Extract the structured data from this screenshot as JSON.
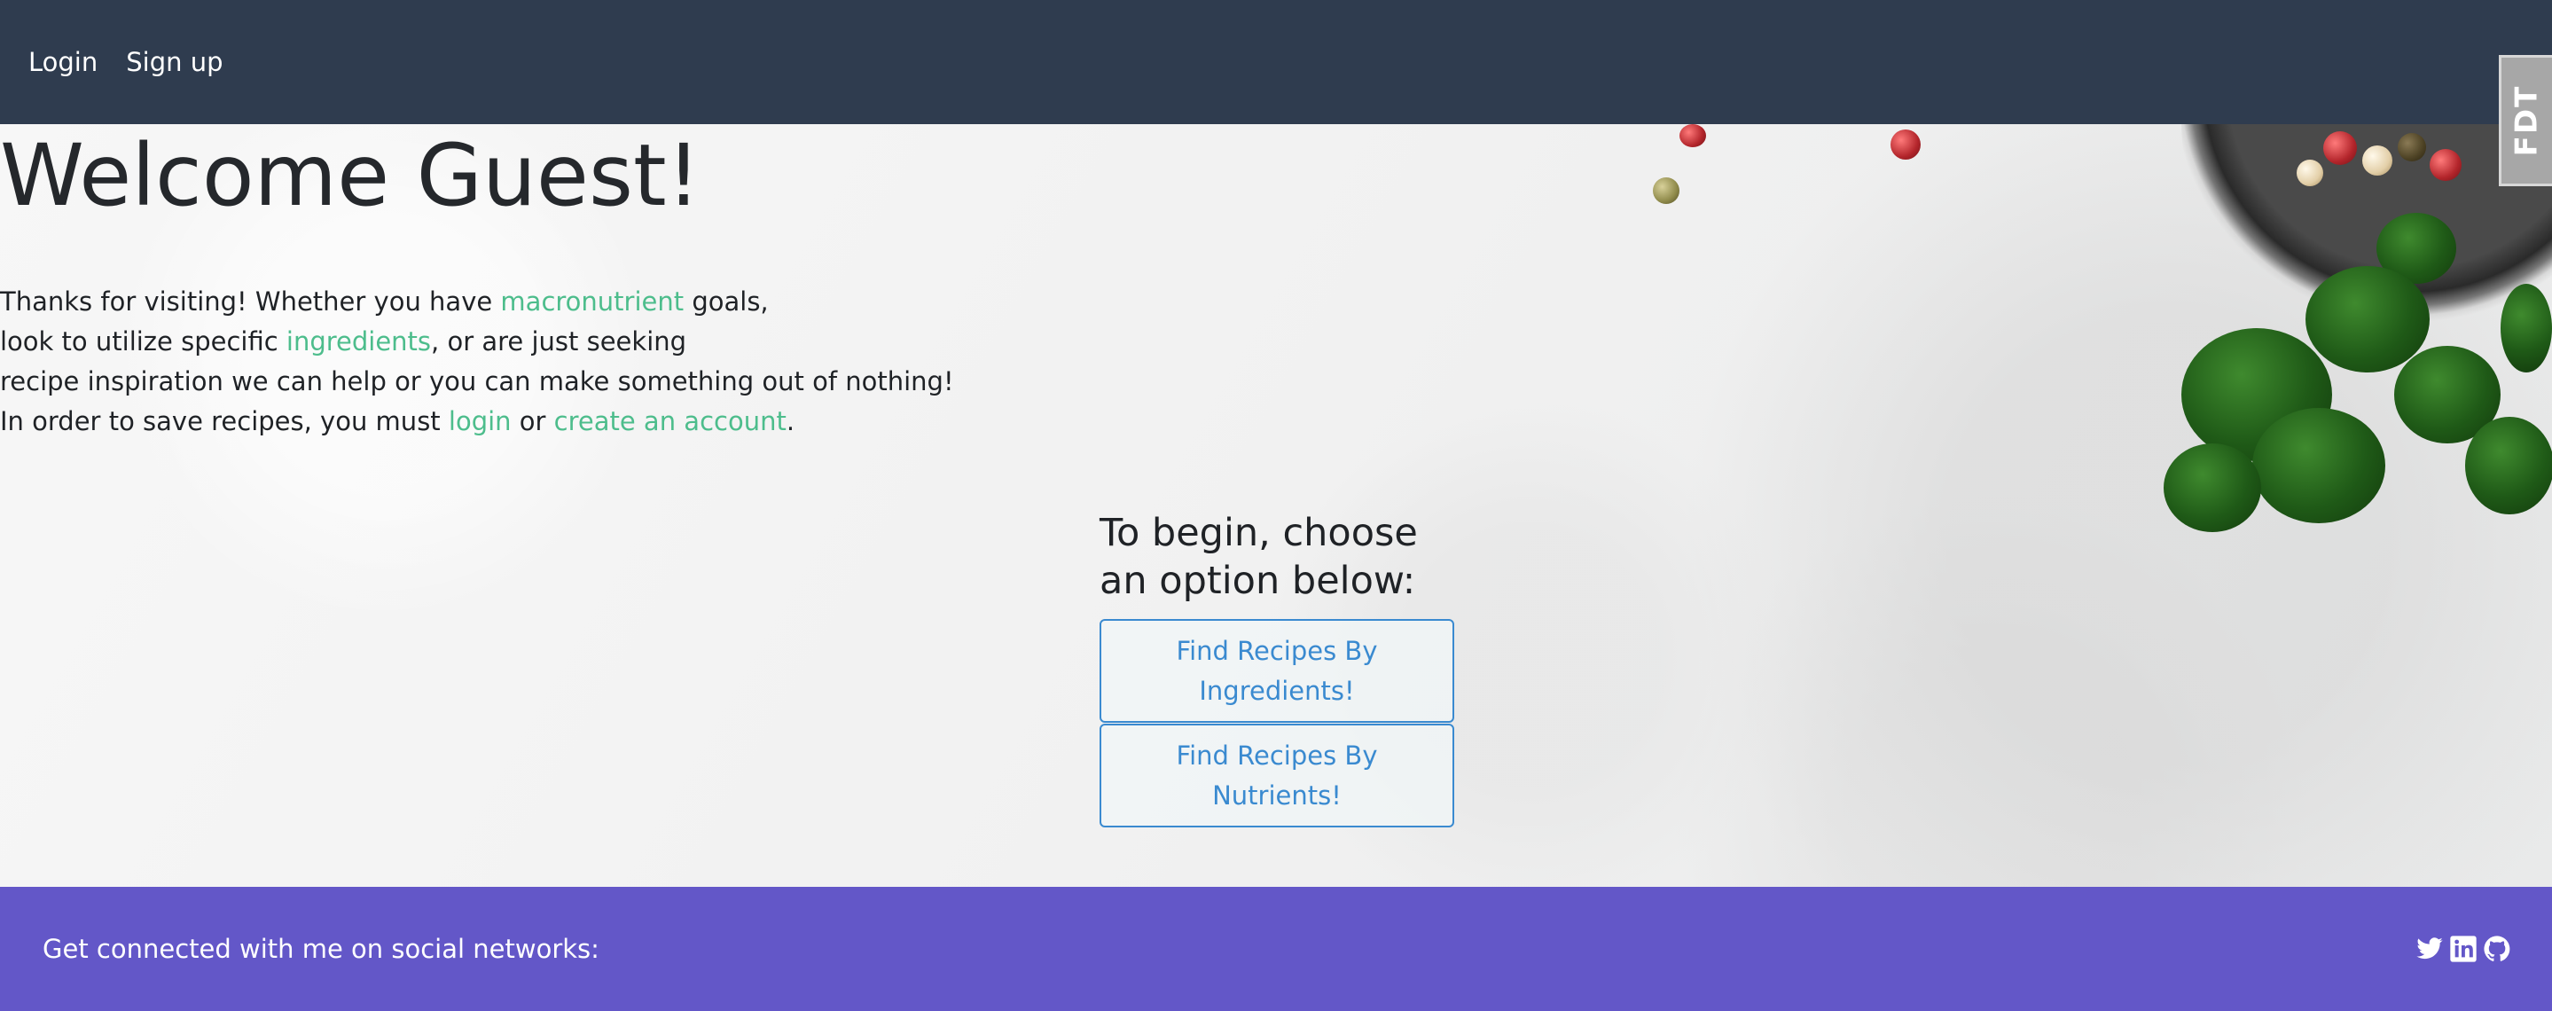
{
  "navbar": {
    "login_label": "Login",
    "signup_label": "Sign up",
    "background": "#2f3c4f"
  },
  "badge": {
    "label": "FDT"
  },
  "main": {
    "title": "Welcome Guest!",
    "intro": {
      "line1_prefix": "Thanks for visiting! Whether you have ",
      "line1_link": "macronutrient",
      "line1_suffix": " goals,",
      "line2_prefix": "look to utilize specific ",
      "line2_link": "ingredients",
      "line2_suffix": ", or are just seeking",
      "line3": "recipe inspiration we can help or you can make something out of nothing!",
      "line4_prefix": "In order to save recipes, you must ",
      "line4_link_login": "login",
      "line4_mid": " or ",
      "line4_link_create": "create an account",
      "line4_suffix": "."
    },
    "begin_heading": "To begin, choose an option below:",
    "buttons": {
      "ingredients_label": "Find Recipes By Ingredients!",
      "nutrients_label": "Find Recipes By Nutrients!"
    },
    "link_color": "#4dbd8c",
    "button_color": "#3a8ad0"
  },
  "footer": {
    "text": "Get connected with me on social networks:",
    "background": "#6357c8",
    "icons": [
      "twitter-icon",
      "linkedin-icon",
      "github-icon"
    ]
  }
}
